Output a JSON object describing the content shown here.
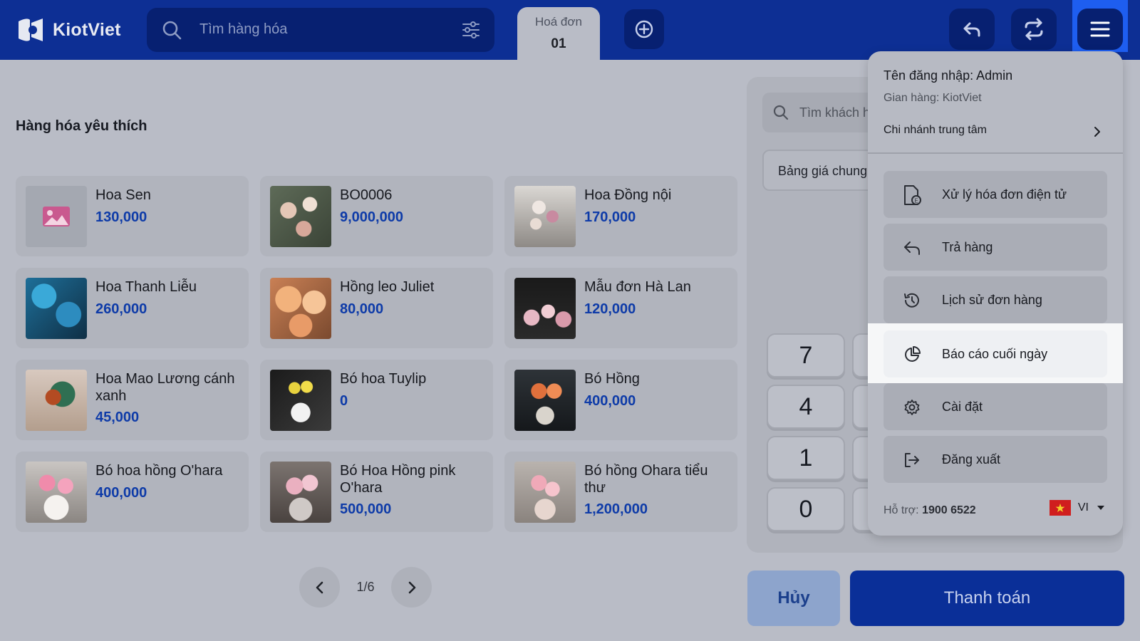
{
  "app": {
    "brand": "KiotViet"
  },
  "search": {
    "placeholder": "Tìm hàng hóa"
  },
  "tab": {
    "label": "Hoá đơn",
    "number": "01"
  },
  "section": {
    "title": "Hàng hóa yêu thích"
  },
  "products": [
    {
      "name": "Hoa Sen",
      "price": "130,000"
    },
    {
      "name": "BO0006",
      "price": "9,000,000"
    },
    {
      "name": "Hoa Đồng nội",
      "price": "170,000"
    },
    {
      "name": "Hoa Thanh Liễu",
      "price": "260,000"
    },
    {
      "name": "Hồng leo Juliet",
      "price": "80,000"
    },
    {
      "name": "Mẫu đơn Hà Lan",
      "price": "120,000"
    },
    {
      "name": "Hoa Mao Lương cánh xanh",
      "price": "45,000"
    },
    {
      "name": "Bó hoa Tuylip",
      "price": "0"
    },
    {
      "name": "Bó Hồng",
      "price": "400,000"
    },
    {
      "name": "Bó hoa hồng O'hara",
      "price": "400,000"
    },
    {
      "name": "Bó Hoa Hồng pink O'hara",
      "price": "500,000"
    },
    {
      "name": "Bó hồng Ohara tiểu thư",
      "price": "1,200,000"
    }
  ],
  "pager": {
    "text": "1/6"
  },
  "customer": {
    "search_placeholder": "Tìm khách h"
  },
  "pricebook": {
    "label": "Bảng giá chung"
  },
  "keypad": {
    "keys": [
      "7",
      "4",
      "1",
      "0"
    ]
  },
  "actions": {
    "cancel": "Hủy",
    "pay": "Thanh toán"
  },
  "menu": {
    "user": "Tên đăng nhập: Admin",
    "shop": "Gian hàng: KiotViet",
    "branch": "Chi nhánh trung tâm",
    "items": [
      {
        "label": "Xử lý hóa đơn điện tử",
        "icon": "e-invoice-icon"
      },
      {
        "label": "Trả hàng",
        "icon": "return-icon"
      },
      {
        "label": "Lịch sử đơn hàng",
        "icon": "history-icon"
      },
      {
        "label": "Báo cáo cuối ngày",
        "icon": "report-icon"
      },
      {
        "label": "Cài đặt",
        "icon": "gear-icon"
      },
      {
        "label": "Đăng xuất",
        "icon": "logout-icon"
      }
    ],
    "support_label": "Hỗ trợ:",
    "support_phone": "1900 6522",
    "language": "VI"
  },
  "colors": {
    "topbar": "#0d2f94",
    "accent": "#1e5ef0",
    "price": "#0e3ba8",
    "pay": "#0a2f98"
  }
}
